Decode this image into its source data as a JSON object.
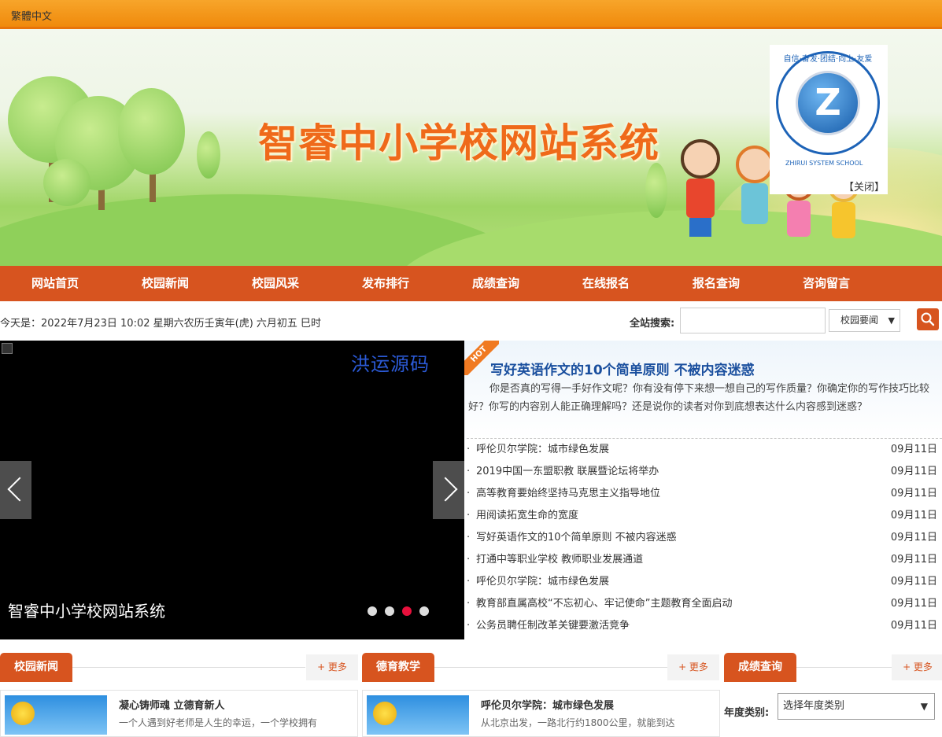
{
  "topbar": {
    "lang_link": "繁體中文"
  },
  "banner": {
    "title": "智睿中小学校网站系统",
    "logo_ring_text": "自信·奋发·团结·向上·友爱",
    "logo_letter": "Z",
    "logo_school": "ZHIRUI SYSTEM SCHOOL",
    "close_label": "【关闭】"
  },
  "nav": [
    "网站首页",
    "校园新闻",
    "校园风采",
    "发布排行",
    "成绩查询",
    "在线报名",
    "报名查询",
    "咨询留言"
  ],
  "datebar": {
    "text": "今天是：2022年7月23日 10:02 星期六农历壬寅年(虎) 六月初五 巳时"
  },
  "search": {
    "label": "全站搜索:",
    "value": "",
    "selected_option": "校园要闻",
    "button_icon": "search-icon"
  },
  "slider": {
    "watermark": "洪运源码",
    "caption": "智睿中小学校网站系统",
    "slide_count": 4,
    "active_index": 2
  },
  "hot": {
    "ribbon": "HOT",
    "headline": "写好英语作文的10个简单原则 不被内容迷惑",
    "summary": "你是否真的写得一手好作文呢？你有没有停下来想一想自己的写作质量？你确定你的写作技巧比较好？你写的内容别人能正确理解吗？还是说你的读者对你到底想表达什么内容感到迷惑？"
  },
  "news": [
    {
      "title": "呼伦贝尔学院：城市绿色发展",
      "date": "09月11日"
    },
    {
      "title": "2019中国一东盟职教 联展暨论坛将举办",
      "date": "09月11日"
    },
    {
      "title": "高等教育要始终坚持马克思主义指导地位",
      "date": "09月11日"
    },
    {
      "title": "用阅读拓宽生命的宽度",
      "date": "09月11日"
    },
    {
      "title": "写好英语作文的10个简单原则 不被内容迷惑",
      "date": "09月11日"
    },
    {
      "title": "打通中等职业学校 教师职业发展通道",
      "date": "09月11日"
    },
    {
      "title": "呼伦贝尔学院：城市绿色发展",
      "date": "09月11日"
    },
    {
      "title": "教育部直属高校“不忘初心、牢记使命”主题教育全面启动",
      "date": "09月11日"
    },
    {
      "title": "公务员聘任制改革关键要激活竞争",
      "date": "09月11日"
    }
  ],
  "sections": [
    {
      "tab": "校园新闻",
      "more": "+ 更多",
      "card_title": "凝心铸师魂 立德育新人",
      "card_snippet": "一个人遇到好老师是人生的幸运，一个学校拥有"
    },
    {
      "tab": "德育教学",
      "more": "+ 更多",
      "card_title": "呼伦贝尔学院：城市绿色发展",
      "card_snippet": "从北京出发，一路北行约1800公里，就能到达"
    },
    {
      "tab": "成绩查询",
      "more": "+ 更多"
    }
  ],
  "grade": {
    "label": "年度类别:",
    "selected": "选择年度类别"
  },
  "colors": {
    "accent": "#d7541f",
    "topbar": "#f39a1e",
    "headline": "#1a4f9e"
  }
}
